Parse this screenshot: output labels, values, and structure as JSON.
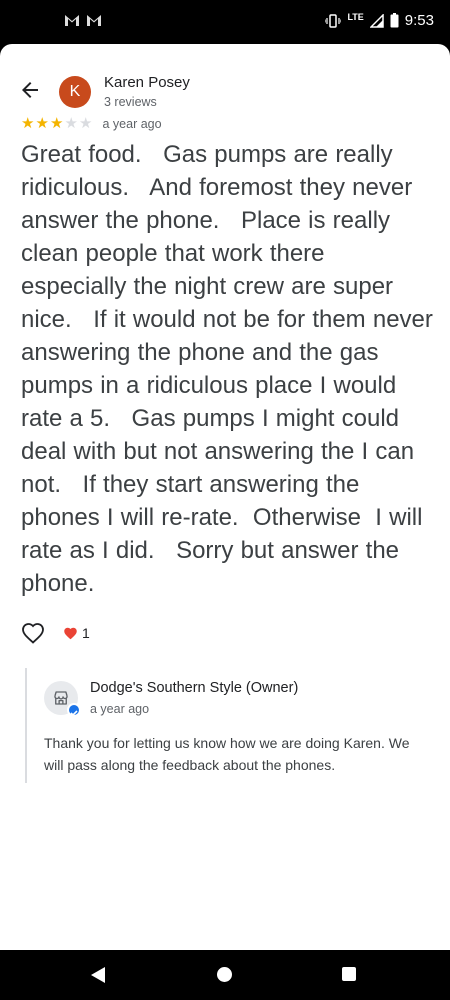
{
  "status_bar": {
    "notification_icons": [
      "gmail-icon",
      "gmail-icon"
    ],
    "network": "LTE",
    "roaming": "R",
    "time": "9:53"
  },
  "header": {
    "back_icon": "arrow-back-icon",
    "avatar_letter": "K",
    "avatar_color": "#c84a1c",
    "reviewer_name": "Karen Posey",
    "reviewer_count": "3 reviews"
  },
  "review": {
    "rating": 3,
    "max_rating": 5,
    "time": "a year ago",
    "text": "Great food.   Gas pumps are really ridiculous.   And foremost they never answer the phone.   Place is really clean people that work there especially the night crew are super nice.   If it would not be for them never answering the phone and the gas pumps in a ridiculous place I would rate a 5.   Gas pumps I might could deal with but not answering the I can not.   If they start answering the phones I will re-rate.  Otherwise  I will  rate as I did.   Sorry but answer the phone."
  },
  "actions": {
    "like_icon": "heart-outline-icon",
    "like_count": "1"
  },
  "owner_reply": {
    "name": "Dodge's Southern Style (Owner)",
    "time": "a year ago",
    "text": "Thank you for letting us know how we are doing Karen. We will pass along the feedback about the phones."
  },
  "colors": {
    "star": "#f4b400",
    "heart": "#ea4335",
    "verified": "#1a73e8"
  }
}
